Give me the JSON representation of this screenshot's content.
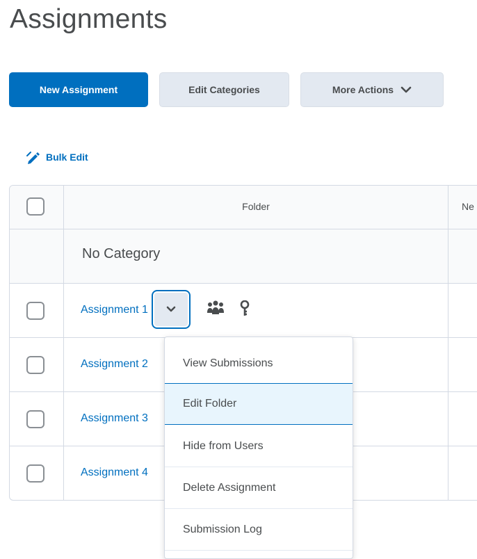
{
  "page": {
    "title": "Assignments"
  },
  "toolbar": {
    "new_assignment": "New Assignment",
    "edit_categories": "Edit Categories",
    "more_actions": "More Actions"
  },
  "bulk_edit": {
    "label": "Bulk Edit",
    "icon": "pencil-icon"
  },
  "table": {
    "columns": [
      "Folder",
      "Ne"
    ],
    "category": "No Category",
    "rows": [
      {
        "name": "Assignment 1"
      },
      {
        "name": "Assignment 2"
      },
      {
        "name": "Assignment 3"
      },
      {
        "name": "Assignment 4"
      }
    ]
  },
  "context_menu": {
    "items": [
      "View Submissions",
      "Edit Folder",
      "Hide from Users",
      "Delete Assignment",
      "Submission Log"
    ],
    "highlighted": "Edit Folder"
  },
  "colors": {
    "primary": "#006fbf",
    "link": "#006fbf",
    "secondary_button": "#e3e9f1",
    "highlight": "#e8f5fd"
  }
}
